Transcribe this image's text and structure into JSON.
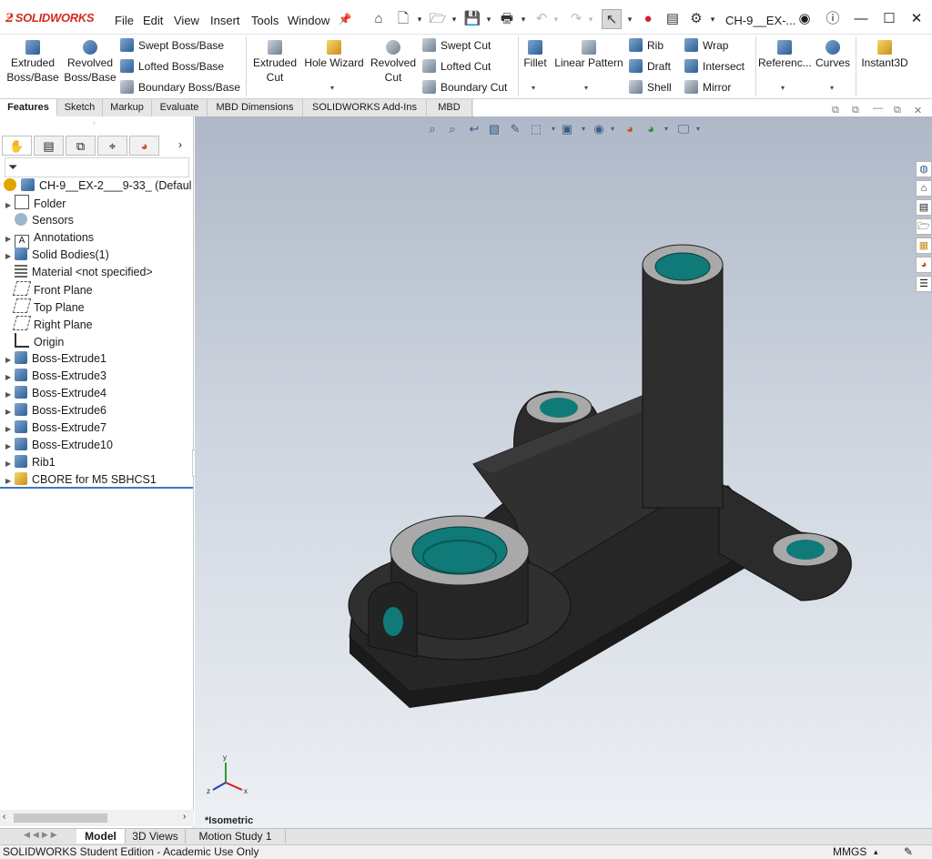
{
  "app": {
    "logo_text": "SOLIDWORKS",
    "brand_color": "#d52b1e"
  },
  "menu": [
    "File",
    "Edit",
    "View",
    "Insert",
    "Tools",
    "Window"
  ],
  "document_title": "CH-9__EX-...",
  "ribbon": {
    "extruded_boss": "Extruded\nBoss/Base",
    "revolved_boss": "Revolved\nBoss/Base",
    "swept_boss": "Swept Boss/Base",
    "lofted_boss": "Lofted Boss/Base",
    "boundary_boss": "Boundary Boss/Base",
    "extruded_cut": "Extruded\nCut",
    "hole_wizard": "Hole Wizard",
    "revolved_cut": "Revolved\nCut",
    "swept_cut": "Swept Cut",
    "lofted_cut": "Lofted Cut",
    "boundary_cut": "Boundary Cut",
    "fillet": "Fillet",
    "linear_pattern": "Linear Pattern",
    "rib": "Rib",
    "draft": "Draft",
    "shell": "Shell",
    "wrap": "Wrap",
    "intersect": "Intersect",
    "mirror": "Mirror",
    "reference": "Referenc...",
    "curves": "Curves",
    "instant3d": "Instant3D"
  },
  "tabs": [
    "Features",
    "Sketch",
    "Markup",
    "Evaluate",
    "MBD Dimensions",
    "SOLIDWORKS Add-Ins",
    "MBD"
  ],
  "tree": {
    "root": "CH-9__EX-2___9-33_ (Defaul",
    "items": [
      "Folder",
      "Sensors",
      "Annotations",
      "Solid Bodies(1)",
      "Material <not specified>",
      "Front Plane",
      "Top Plane",
      "Right Plane",
      "Origin",
      "Boss-Extrude1",
      "Boss-Extrude3",
      "Boss-Extrude4",
      "Boss-Extrude6",
      "Boss-Extrude7",
      "Boss-Extrude10",
      "Rib1",
      "CBORE for M5 SBHCS1"
    ]
  },
  "view_label": "*Isometric",
  "bottom_tabs": [
    "Model",
    "3D Views",
    "Motion Study 1"
  ],
  "status": {
    "edition": "SOLIDWORKS Student Edition - Academic Use Only",
    "units": "MMGS"
  },
  "colors": {
    "part_body": "#2b2b2b",
    "hole_teal": "#0f7a78",
    "face_gray": "#a9a9a9"
  },
  "axis": {
    "x": "x",
    "y": "y",
    "z": "z"
  }
}
